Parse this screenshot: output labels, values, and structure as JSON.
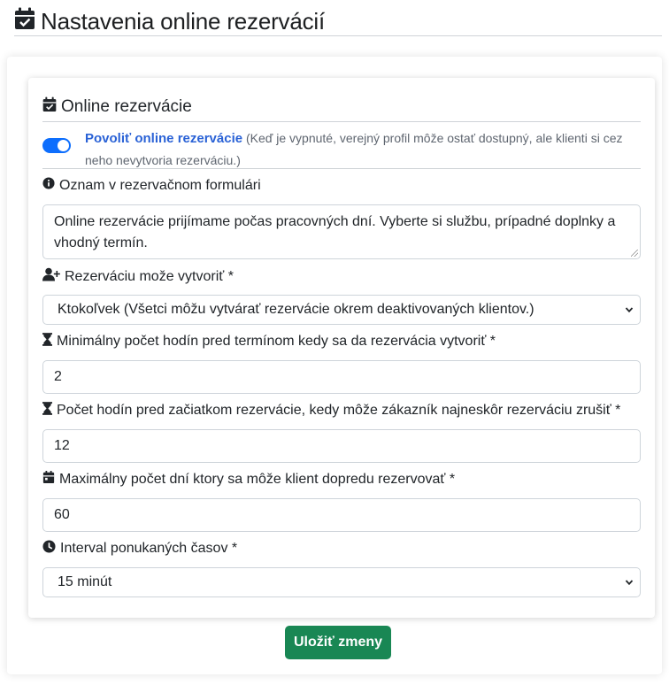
{
  "header": {
    "title": "Nastavenia online rezervácií",
    "icon": "calendar-check-icon"
  },
  "section": {
    "title": "Online rezervácie",
    "icon": "calendar-check-icon"
  },
  "toggle": {
    "label": "Povoliť online rezervácie",
    "hint": "(Keď je vypnuté, verejný profil môže ostať dostupný, ale klienti si cez neho nevytvoria rezerváciu.)",
    "enabled": true
  },
  "fields": {
    "notice": {
      "label": "Oznam v rezervačnom formulári",
      "icon": "info-circle-icon",
      "value": "Online rezervácie prijímame počas pracovných dní. Vyberte si službu, prípadné doplnky a vhodný termín."
    },
    "who_can_book": {
      "label": "Rezerváciu može vytvoriť *",
      "icon": "user-plus-icon",
      "value": "Ktokoľvek (Všetci môžu vytvárať rezervácie okrem deaktivovaných klientov.)"
    },
    "min_hours_before": {
      "label": "Minimálny počet hodín pred termínom kedy sa da rezervácia vytvoriť *",
      "icon": "hourglass-icon",
      "value": "2"
    },
    "cancel_hours_before": {
      "label": "Počet hodín pred začiatkom rezervácie, kedy môže zákazník najneskôr rezerváciu zrušiť *",
      "icon": "hourglass-icon",
      "value": "12"
    },
    "max_days_ahead": {
      "label": "Maximálny počet dní ktory sa môže klient dopredu rezervovať *",
      "icon": "calendar-icon",
      "value": "60"
    },
    "interval": {
      "label": "Interval ponukaných časov *",
      "icon": "clock-icon",
      "value": "15 minút"
    }
  },
  "actions": {
    "save_label": "Uložiť zmeny"
  },
  "colors": {
    "primary": "#0d6efd",
    "link": "#2a62d6",
    "success": "#198754",
    "border": "#ced4da"
  }
}
